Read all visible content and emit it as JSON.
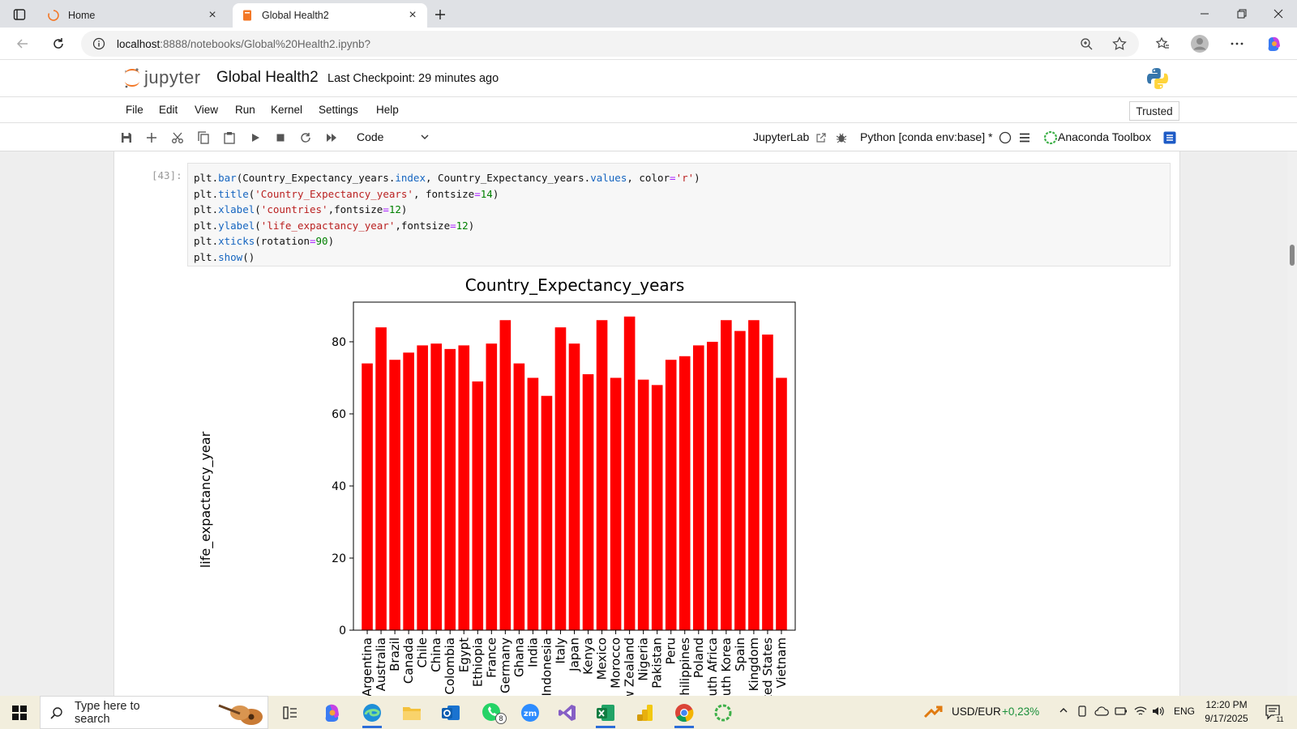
{
  "browser": {
    "tabs": [
      {
        "label": "Home",
        "active": false
      },
      {
        "label": "Global Health2",
        "active": true
      }
    ],
    "url_host": "localhost",
    "url_rest": ":8888/notebooks/Global%20Health2.ipynb?"
  },
  "jupyter": {
    "logo_text": "jupyter",
    "notebook_title": "Global Health2",
    "checkpoint": "Last Checkpoint: 29 minutes ago",
    "menu": [
      "File",
      "Edit",
      "View",
      "Run",
      "Kernel",
      "Settings",
      "Help"
    ],
    "trusted": "Trusted",
    "cell_type": "Code",
    "jupyterlab_link": "JupyterLab",
    "kernel": "Python [conda env:base] *",
    "anaconda": "Anaconda Toolbox"
  },
  "cell": {
    "prompt": "[43]:",
    "code_lines": [
      "plt.bar(Country_Expectancy_years.index, Country_Expectancy_years.values, color='r')",
      "plt.title('Country_Expectancy_years', fontsize=14)",
      "plt.xlabel('countries',fontsize=12)",
      "plt.ylabel('life_expactancy_year',fontsize=12)",
      "plt.xticks(rotation=90)",
      "plt.show()"
    ]
  },
  "chart_data": {
    "type": "bar",
    "title": "Country_Expectancy_years",
    "xlabel": "",
    "ylabel": "life_expactancy_year",
    "color": "#ff0000",
    "ylim": [
      0,
      91
    ],
    "yticks": [
      0,
      20,
      40,
      60,
      80
    ],
    "grid": false,
    "categories": [
      "Argentina",
      "Australia",
      "Brazil",
      "Canada",
      "Chile",
      "China",
      "Colombia",
      "Egypt",
      "Ethiopia",
      "France",
      "Germany",
      "Ghana",
      "India",
      "Indonesia",
      "Italy",
      "Japan",
      "Kenya",
      "Mexico",
      "Morocco",
      "New Zealand",
      "Nigeria",
      "Pakistan",
      "Peru",
      "Philippines",
      "Poland",
      "South Africa",
      "South Korea",
      "Spain",
      "United Kingdom",
      "United States",
      "Vietnam"
    ],
    "values": [
      74,
      84,
      75,
      77,
      79,
      79.5,
      78,
      79,
      69,
      79.5,
      86,
      74,
      70,
      65,
      84,
      79.5,
      71,
      86,
      70,
      87,
      69.5,
      68,
      75,
      76,
      79,
      80,
      86,
      83,
      86,
      82,
      70
    ]
  },
  "taskbar": {
    "search_placeholder": "Type here to search",
    "whatsapp_badge": "8",
    "currency": "USD/EUR",
    "currency_change": "+0,23%",
    "language": "ENG",
    "time": "12:20 PM",
    "date": "9/17/2025",
    "notification_count": "11"
  },
  "colors": {
    "jupyter_orange": "#f37726",
    "bar_red": "#ff0000",
    "code_attr_blue": "#1565c0",
    "code_string_red": "#ba2121",
    "code_number_green": "#008000"
  }
}
